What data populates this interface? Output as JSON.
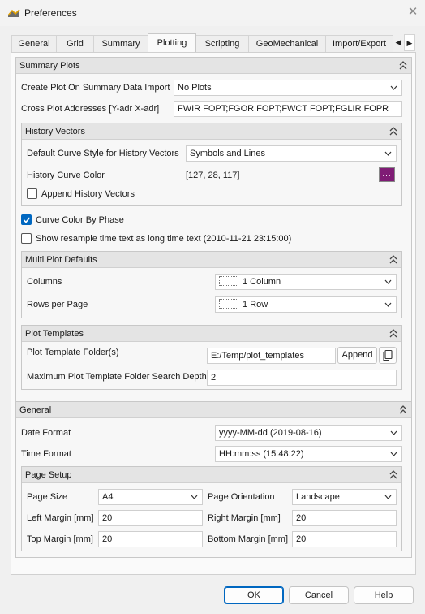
{
  "window": {
    "title": "Preferences",
    "close_glyph": "✕"
  },
  "tabs": [
    {
      "label": "General"
    },
    {
      "label": "Grid"
    },
    {
      "label": "Summary"
    },
    {
      "label": "Plotting",
      "active": true
    },
    {
      "label": "Scripting"
    },
    {
      "label": "GeoMechanical"
    },
    {
      "label": "Import/Export"
    }
  ],
  "summary_plots": {
    "title": "Summary Plots",
    "create_plot_label": "Create Plot On Summary Data Import",
    "create_plot_value": "No Plots",
    "cross_plot_label": "Cross Plot Addresses [Y-adr X-adr]",
    "cross_plot_value": "FWIR FOPT;FGOR FOPT;FWCT FOPT;FGLIR FOPR",
    "history_vectors": {
      "title": "History Vectors",
      "curve_style_label": "Default Curve Style for History Vectors",
      "curve_style_value": "Symbols and Lines",
      "curve_color_label": "History Curve Color",
      "curve_color_value": "[127, 28, 117]",
      "curve_color_hex": "#7f1c75",
      "color_button_label": "...",
      "append_label": "Append History Vectors",
      "append_checked": false
    },
    "curve_color_by_phase_label": "Curve Color By Phase",
    "curve_color_by_phase_checked": true,
    "show_resample_label": "Show resample time text as long time text (2010-11-21 23:15:00)",
    "show_resample_checked": false,
    "multi_plot": {
      "title": "Multi Plot Defaults",
      "columns_label": "Columns",
      "columns_value": "1 Column",
      "rows_label": "Rows per Page",
      "rows_value": "1 Row"
    },
    "plot_templates": {
      "title": "Plot Templates",
      "folder_label": "Plot Template Folder(s)",
      "folder_value": "E:/Temp/plot_templates",
      "append_button": "Append",
      "depth_label": "Maximum Plot Template Folder Search Depth",
      "depth_value": "2"
    }
  },
  "general": {
    "title": "General",
    "date_format_label": "Date Format",
    "date_format_value": "yyyy-MM-dd (2019-08-16)",
    "time_format_label": "Time Format",
    "time_format_value": "HH:mm:ss (15:48:22)",
    "page_setup": {
      "title": "Page Setup",
      "page_size_label": "Page Size",
      "page_size_value": "A4",
      "orientation_label": "Page Orientation",
      "orientation_value": "Landscape",
      "left_margin_label": "Left Margin [mm]",
      "left_margin_value": "20",
      "right_margin_label": "Right Margin [mm]",
      "right_margin_value": "20",
      "top_margin_label": "Top Margin [mm]",
      "top_margin_value": "20",
      "bottom_margin_label": "Bottom Margin [mm]",
      "bottom_margin_value": "20"
    }
  },
  "buttons": {
    "ok": "OK",
    "cancel": "Cancel",
    "help": "Help"
  },
  "colors": {
    "accent": "#0067c0",
    "history_curve": "#7f1c75"
  },
  "icons": [
    "app-icon",
    "close-icon",
    "collapse-up-icon",
    "chevron-down-icon",
    "copy-icon",
    "check-icon",
    "tab-scroll-left-icon",
    "tab-scroll-right-icon"
  ]
}
